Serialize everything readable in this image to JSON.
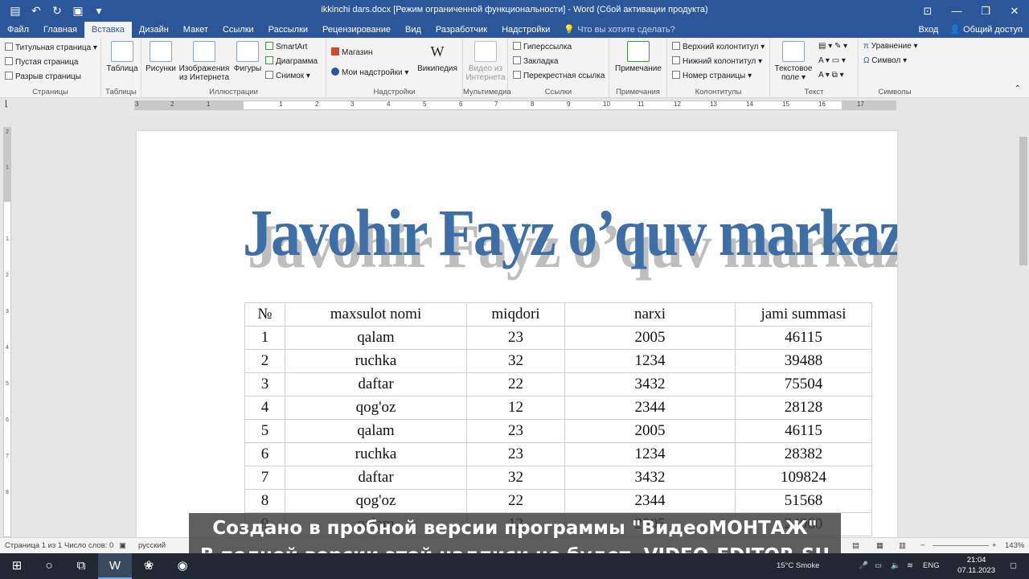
{
  "titlebar": {
    "title": "ikkinchi dars.docx [Режим ограниченной функциональности] - Word (Сбой активации продукта)",
    "quick_access": [
      "file-icon",
      "undo-icon",
      "redo-icon",
      "save-icon",
      "more-icon"
    ]
  },
  "tabs": [
    "Файл",
    "Главная",
    "Вставка",
    "Дизайн",
    "Макет",
    "Ссылки",
    "Рассылки",
    "Рецензирование",
    "Вид",
    "Разработчик",
    "Надстройки"
  ],
  "active_tab": "Вставка",
  "tell_me": "Что вы хотите сделать?",
  "account": {
    "signin": "Вход",
    "share": "Общий доступ"
  },
  "ribbon": {
    "pages": {
      "items": [
        "Титульная страница",
        "Пустая страница",
        "Разрыв страницы"
      ],
      "label": "Страницы"
    },
    "tables": {
      "button": "Таблица",
      "label": "Таблицы"
    },
    "illustrations": {
      "pictures": "Рисунки",
      "online_pictures_1": "Изображения",
      "online_pictures_2": "из Интернета",
      "shapes": "Фигуры",
      "smartart": "SmartArt",
      "chart": "Диаграмма",
      "screenshot": "Снимок",
      "label": "Иллюстрации"
    },
    "addins": {
      "store": "Магазин",
      "my_addins": "Мои надстройки",
      "wikipedia": "Википедия",
      "label": "Надстройки"
    },
    "media": {
      "video_1": "Видео из",
      "video_2": "Интернета",
      "label": "Мультимедиа"
    },
    "links": {
      "hyperlink": "Гиперссылка",
      "bookmark": "Закладка",
      "cross_ref": "Перекрестная ссылка",
      "label": "Ссылки"
    },
    "comments": {
      "comment": "Примечание",
      "label": "Примечания"
    },
    "header_footer": {
      "header": "Верхний колонтитул",
      "footer": "Нижний колонтитул",
      "page_number": "Номер страницы",
      "label": "Колонтитулы"
    },
    "text": {
      "textbox_1": "Текстовое",
      "textbox_2": "поле",
      "label": "Текст"
    },
    "symbols": {
      "equation": "Уравнение",
      "symbol": "Символ",
      "label": "Символы"
    }
  },
  "ruler": {
    "numbers": [
      "3",
      "2",
      "1",
      "1",
      "2",
      "3",
      "4",
      "5",
      "6",
      "7",
      "8",
      "9",
      "10",
      "11",
      "12",
      "13",
      "14",
      "15",
      "16",
      "17"
    ],
    "vertical_numbers": [
      "2",
      "1",
      "1",
      "2",
      "3",
      "4",
      "5",
      "6",
      "7",
      "8"
    ]
  },
  "document": {
    "wordart": "Javohir Fayz o’quv markazi",
    "table": {
      "headers": [
        "№",
        "maxsulot nomi",
        "miqdori",
        "narxi",
        "jami summasi"
      ],
      "rows": [
        [
          "1",
          "qalam",
          "23",
          "2005",
          "46115"
        ],
        [
          "2",
          "ruchka",
          "32",
          "1234",
          "39488"
        ],
        [
          "3",
          "daftar",
          "22",
          "3432",
          "75504"
        ],
        [
          "4",
          "qog'oz",
          "12",
          "2344",
          "28128"
        ],
        [
          "5",
          "qalam",
          "23",
          "2005",
          "46115"
        ],
        [
          "6",
          "ruchka",
          "23",
          "1234",
          "28382"
        ],
        [
          "7",
          "daftar",
          "32",
          "3432",
          "109824"
        ],
        [
          "8",
          "qog'oz",
          "22",
          "2344",
          "51568"
        ],
        [
          "9",
          "qalam",
          "12",
          "2005",
          "24060"
        ]
      ]
    }
  },
  "statusbar": {
    "page": "Страница 1 из 1",
    "words": "Число слов: 0",
    "language": "русский",
    "zoom": "143%"
  },
  "watermark": {
    "line1": "Создано в пробной версии программы \"ВидеоМОНТАЖ\"",
    "line2": "В полной версии этой надписи не будет. VIDEO-EDITOR.SU"
  },
  "taskbar": {
    "weather": "15°C Smoke",
    "lang": "ENG",
    "time": "21:04",
    "date": "07.11.2023"
  },
  "colors": {
    "word_blue": "#2b579a",
    "wordart_blue": "#3d6fa6",
    "taskbar": "#1f2833"
  }
}
